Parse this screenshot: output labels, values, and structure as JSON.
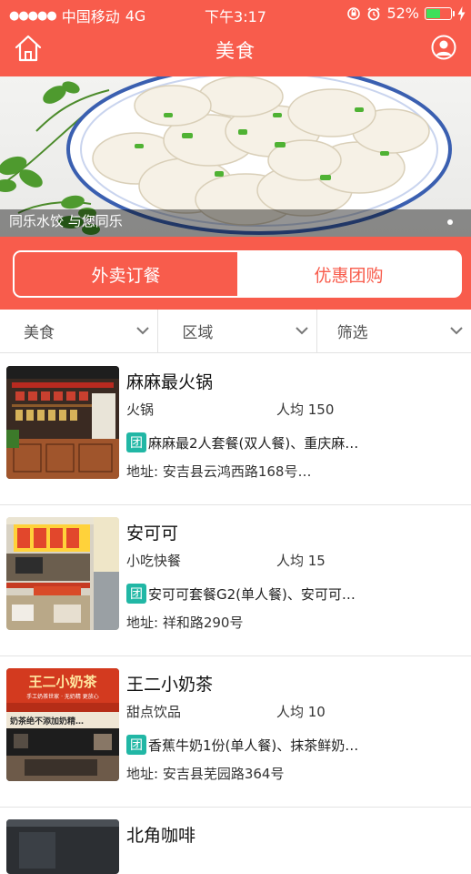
{
  "status_bar": {
    "signal_dots": "●●●●●",
    "carrier": "中国移动",
    "network": "4G",
    "time": "下午3:17",
    "battery_percent": "52%",
    "battery_level": 0.52
  },
  "nav": {
    "title": "美食",
    "home_icon": "home-icon",
    "user_icon": "user-icon"
  },
  "banner": {
    "caption": "同乐水饺 与您同乐"
  },
  "segment": {
    "tabs": [
      {
        "label": "外卖订餐",
        "active": true
      },
      {
        "label": "优惠团购",
        "active": false
      }
    ]
  },
  "filters": [
    {
      "label": "美食"
    },
    {
      "label": "区域"
    },
    {
      "label": "筛选"
    }
  ],
  "restaurants": [
    {
      "name": "麻麻最火锅",
      "category": "火锅",
      "avg_price": "人均 150",
      "deal_badge": "团",
      "deal": "麻麻最2人套餐(双人餐)、重庆麻…",
      "address": "地址: 安吉县云鸿西路168号…"
    },
    {
      "name": "安可可",
      "category": "小吃快餐",
      "avg_price": "人均 15",
      "deal_badge": "团",
      "deal": "安可可套餐G2(单人餐)、安可可…",
      "address": "地址: 祥和路290号"
    },
    {
      "name": "王二小奶茶",
      "category": "甜点饮品",
      "avg_price": "人均 10",
      "deal_badge": "团",
      "deal": "香蕉牛奶1份(单人餐)、抹茶鲜奶…",
      "address": "地址: 安吉县芜园路364号",
      "sign_text": "王二小奶茶",
      "sign_subtext": "手工奶茶世家 · 无奶精 更放心",
      "sign_strip": "奶茶绝不添加奶精…"
    },
    {
      "name": "北角咖啡"
    }
  ],
  "colors": {
    "brand": "#f85c4c",
    "deal_badge": "#21b7a5",
    "battery_fill": "#3ee05a"
  }
}
